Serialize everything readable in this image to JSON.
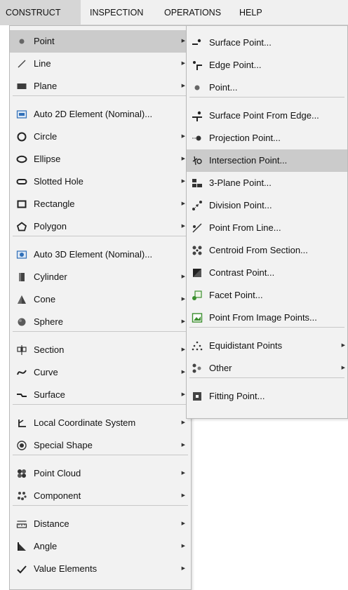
{
  "menubar": {
    "items": [
      {
        "label": "CONSTRUCT"
      },
      {
        "label": "INSPECTION"
      },
      {
        "label": "OPERATIONS"
      },
      {
        "label": "HELP"
      }
    ]
  },
  "construct_menu": {
    "items": [
      {
        "label": "Point",
        "icon": "point-dot-icon",
        "submenu": true,
        "active": true
      },
      {
        "label": "Line",
        "icon": "line-icon",
        "submenu": true
      },
      {
        "label": "Plane",
        "icon": "plane-icon",
        "submenu": true
      },
      {
        "label": "Auto 2D Element (Nominal)...",
        "icon": "auto-2d-element-icon",
        "submenu": false
      },
      {
        "label": "Circle",
        "icon": "circle-icon",
        "submenu": true
      },
      {
        "label": "Ellipse",
        "icon": "ellipse-icon",
        "submenu": true
      },
      {
        "label": "Slotted Hole",
        "icon": "slotted-hole-icon",
        "submenu": true
      },
      {
        "label": "Rectangle",
        "icon": "rectangle-icon",
        "submenu": true
      },
      {
        "label": "Polygon",
        "icon": "polygon-icon",
        "submenu": true
      },
      {
        "label": "Auto 3D Element (Nominal)...",
        "icon": "auto-3d-element-icon",
        "submenu": false
      },
      {
        "label": "Cylinder",
        "icon": "cylinder-icon",
        "submenu": true
      },
      {
        "label": "Cone",
        "icon": "cone-icon",
        "submenu": true
      },
      {
        "label": "Sphere",
        "icon": "sphere-icon",
        "submenu": true
      },
      {
        "label": "Section",
        "icon": "section-icon",
        "submenu": true
      },
      {
        "label": "Curve",
        "icon": "curve-icon",
        "submenu": true
      },
      {
        "label": "Surface",
        "icon": "surface-icon",
        "submenu": true
      },
      {
        "label": "Local Coordinate System",
        "icon": "coordinate-system-icon",
        "submenu": true
      },
      {
        "label": "Special Shape",
        "icon": "special-shape-icon",
        "submenu": true
      },
      {
        "label": "Point Cloud",
        "icon": "point-cloud-icon",
        "submenu": true
      },
      {
        "label": "Component",
        "icon": "component-icon",
        "submenu": true
      },
      {
        "label": "Distance",
        "icon": "distance-icon",
        "submenu": true
      },
      {
        "label": "Angle",
        "icon": "angle-icon",
        "submenu": true
      },
      {
        "label": "Value Elements",
        "icon": "value-elements-icon",
        "submenu": true
      }
    ]
  },
  "point_submenu": {
    "items": [
      {
        "label": "Surface Point...",
        "icon": "surface-point-icon",
        "submenu": false
      },
      {
        "label": "Edge Point...",
        "icon": "edge-point-icon",
        "submenu": false
      },
      {
        "label": "Point...",
        "icon": "point-icon",
        "submenu": false
      },
      {
        "label": "Surface Point From Edge...",
        "icon": "surface-point-from-edge-icon",
        "submenu": false
      },
      {
        "label": "Projection Point...",
        "icon": "projection-point-icon",
        "submenu": false
      },
      {
        "label": "Intersection Point...",
        "icon": "intersection-point-icon",
        "submenu": false,
        "active": true
      },
      {
        "label": "3-Plane Point...",
        "icon": "three-plane-point-icon",
        "submenu": false
      },
      {
        "label": "Division Point...",
        "icon": "division-point-icon",
        "submenu": false
      },
      {
        "label": "Point From Line...",
        "icon": "point-from-line-icon",
        "submenu": false
      },
      {
        "label": "Centroid From Section...",
        "icon": "centroid-from-section-icon",
        "submenu": false
      },
      {
        "label": "Contrast Point...",
        "icon": "contrast-point-icon",
        "submenu": false
      },
      {
        "label": "Facet Point...",
        "icon": "facet-point-icon",
        "submenu": false
      },
      {
        "label": "Point From Image Points...",
        "icon": "point-from-image-points-icon",
        "submenu": false
      },
      {
        "label": "Equidistant Points",
        "icon": "equidistant-points-icon",
        "submenu": true
      },
      {
        "label": "Other",
        "icon": "other-icon",
        "submenu": true
      },
      {
        "label": "Fitting Point...",
        "icon": "fitting-point-icon",
        "submenu": false
      }
    ]
  }
}
